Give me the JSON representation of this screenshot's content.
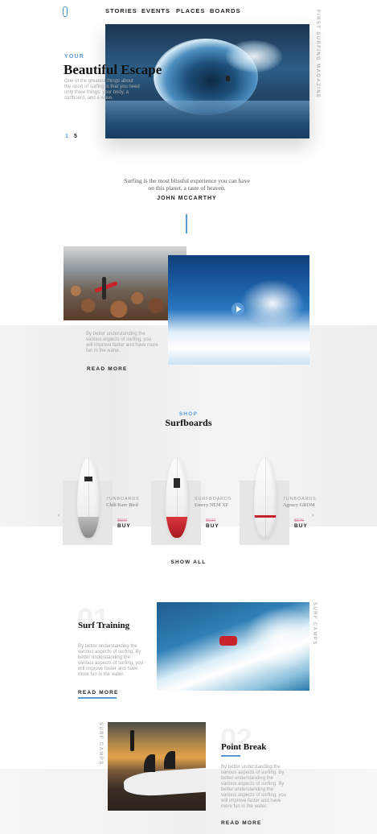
{
  "nav": {
    "items": [
      {
        "label": "STORIES"
      },
      {
        "label": "EVENTS"
      },
      {
        "label": "PLACES"
      },
      {
        "label": "BOARDS"
      }
    ]
  },
  "side_vertical_text": "FIRST SURFING MAGAZINE",
  "hero": {
    "kicker": "YOUR",
    "title": "Beautiful Escape",
    "description": "One of the greatest things about the sport of surfing is that you need only three things: your body, a surfboard, and a wave.",
    "pager_current": "1",
    "pager_total": "5"
  },
  "quote": {
    "text": "Surfing is the most blissful experience you can have on this planet, a taste of heaven.",
    "author": "JOHN MCCARTHY"
  },
  "story": {
    "description": "By better understanding the various aspects of surfing, you will improve faster and have more fun in the water.",
    "read_more": "READ MORE"
  },
  "shop": {
    "kicker": "SHOP",
    "title": "Surfboards",
    "show_all": "SHOW ALL",
    "boards": [
      {
        "brand": "7UNBOARDS",
        "name": "Chili Rare Bird",
        "old_price": "$590",
        "buy": "BUY"
      },
      {
        "brand": "SURFBOARDS",
        "name": "Emery NEM XF",
        "old_price": "$590",
        "buy": "BUY"
      },
      {
        "brand": "7UNBOARDS",
        "name": "Agency GROM",
        "old_price": "$670",
        "buy": "BUY"
      }
    ]
  },
  "training": {
    "number": "01",
    "title": "Surf Training",
    "description": "By better understanding the various aspects of surfing. By better understanding the various aspects of surfing, you will improve faster and have more fun in the water.",
    "read_more": "READ MORE",
    "side_label": "SURF CAMPS"
  },
  "point_break": {
    "number": "02",
    "title": "Point Break",
    "description": "By better understanding the various aspects of surfing. By better understanding the various aspects of surfing. By better understanding the various aspects of surfing, you will improve faster and have more fun in the water.",
    "read_more": "READ MORE",
    "side_label": "SURF CAMPS"
  },
  "colors": {
    "accent": "#5b9bd5",
    "sale": "#e08aa8",
    "board_red": "#c8222a"
  }
}
